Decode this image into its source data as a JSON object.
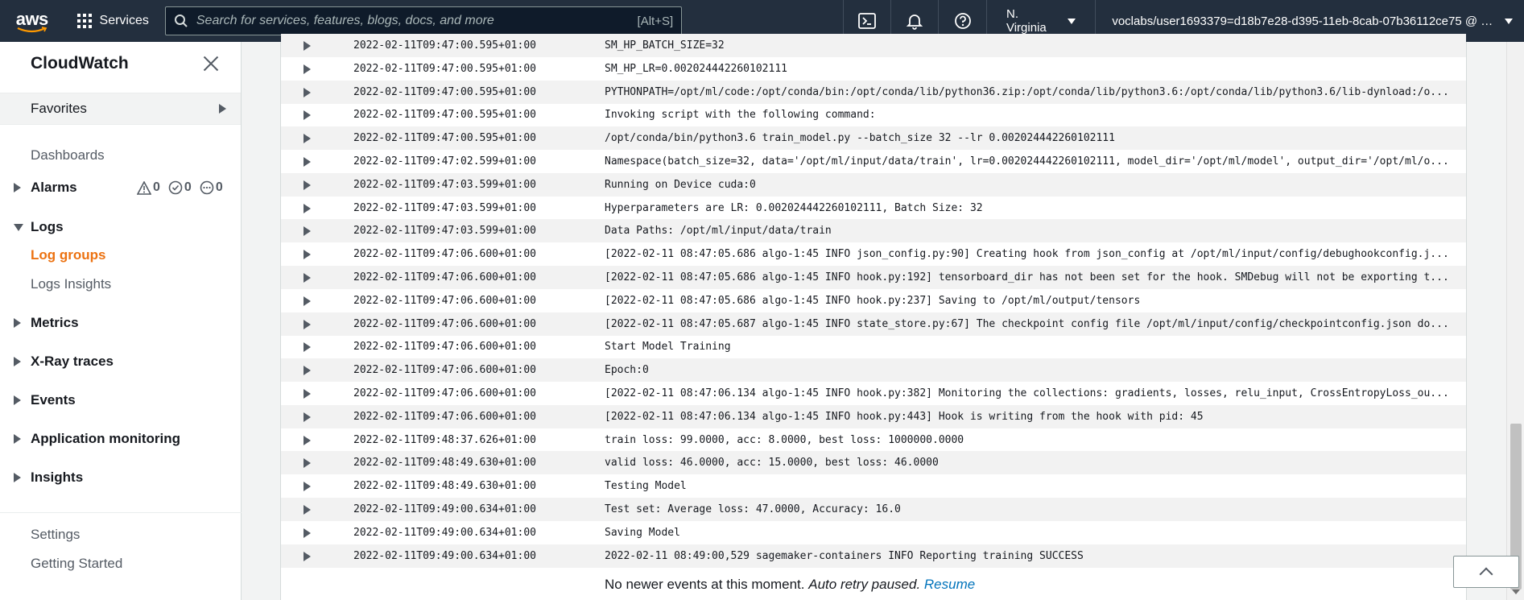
{
  "topnav": {
    "logo_text": "aws",
    "services_label": "Services",
    "search_placeholder": "Search for services, features, blogs, docs, and more",
    "search_shortcut": "[Alt+S]",
    "region": "N. Virginia",
    "account": "voclabs/user1693379=d18b7e28-d395-11eb-8cab-07b36112ce75 @ 32..."
  },
  "sidebar": {
    "title": "CloudWatch",
    "favorites": "Favorites",
    "dashboards": "Dashboards",
    "alarms": "Alarms",
    "alarm_counts": {
      "alarm": "0",
      "ok": "0",
      "insufficient": "0"
    },
    "logs": "Logs",
    "log_groups": "Log groups",
    "logs_insights": "Logs Insights",
    "metrics": "Metrics",
    "xray": "X-Ray traces",
    "events": "Events",
    "app_monitoring": "Application monitoring",
    "insights": "Insights",
    "settings": "Settings",
    "getting_started": "Getting Started"
  },
  "log_events": [
    {
      "ts": "2022-02-11T09:47:00.595+01:00",
      "msg": "SM_HP_BATCH_SIZE=32"
    },
    {
      "ts": "2022-02-11T09:47:00.595+01:00",
      "msg": "SM_HP_LR=0.002024442260102111"
    },
    {
      "ts": "2022-02-11T09:47:00.595+01:00",
      "msg": "PYTHONPATH=/opt/ml/code:/opt/conda/bin:/opt/conda/lib/python36.zip:/opt/conda/lib/python3.6:/opt/conda/lib/python3.6/lib-dynload:/o..."
    },
    {
      "ts": "2022-02-11T09:47:00.595+01:00",
      "msg": "Invoking script with the following command:"
    },
    {
      "ts": "2022-02-11T09:47:00.595+01:00",
      "msg": "/opt/conda/bin/python3.6 train_model.py --batch_size 32 --lr 0.002024442260102111"
    },
    {
      "ts": "2022-02-11T09:47:02.599+01:00",
      "msg": "Namespace(batch_size=32, data='/opt/ml/input/data/train', lr=0.002024442260102111, model_dir='/opt/ml/model', output_dir='/opt/ml/o..."
    },
    {
      "ts": "2022-02-11T09:47:03.599+01:00",
      "msg": "Running on Device cuda:0"
    },
    {
      "ts": "2022-02-11T09:47:03.599+01:00",
      "msg": "Hyperparameters are LR: 0.002024442260102111, Batch Size: 32"
    },
    {
      "ts": "2022-02-11T09:47:03.599+01:00",
      "msg": "Data Paths: /opt/ml/input/data/train"
    },
    {
      "ts": "2022-02-11T09:47:06.600+01:00",
      "msg": "[2022-02-11 08:47:05.686 algo-1:45 INFO json_config.py:90] Creating hook from json_config at /opt/ml/input/config/debughookconfig.j..."
    },
    {
      "ts": "2022-02-11T09:47:06.600+01:00",
      "msg": "[2022-02-11 08:47:05.686 algo-1:45 INFO hook.py:192] tensorboard_dir has not been set for the hook. SMDebug will not be exporting t..."
    },
    {
      "ts": "2022-02-11T09:47:06.600+01:00",
      "msg": "[2022-02-11 08:47:05.686 algo-1:45 INFO hook.py:237] Saving to /opt/ml/output/tensors"
    },
    {
      "ts": "2022-02-11T09:47:06.600+01:00",
      "msg": "[2022-02-11 08:47:05.687 algo-1:45 INFO state_store.py:67] The checkpoint config file /opt/ml/input/config/checkpointconfig.json do..."
    },
    {
      "ts": "2022-02-11T09:47:06.600+01:00",
      "msg": "Start Model Training"
    },
    {
      "ts": "2022-02-11T09:47:06.600+01:00",
      "msg": "Epoch:0"
    },
    {
      "ts": "2022-02-11T09:47:06.600+01:00",
      "msg": "[2022-02-11 08:47:06.134 algo-1:45 INFO hook.py:382] Monitoring the collections: gradients, losses, relu_input, CrossEntropyLoss_ou..."
    },
    {
      "ts": "2022-02-11T09:47:06.600+01:00",
      "msg": "[2022-02-11 08:47:06.134 algo-1:45 INFO hook.py:443] Hook is writing from the hook with pid: 45"
    },
    {
      "ts": "2022-02-11T09:48:37.626+01:00",
      "msg": "train loss: 99.0000, acc: 8.0000, best loss: 1000000.0000"
    },
    {
      "ts": "2022-02-11T09:48:49.630+01:00",
      "msg": "valid loss: 46.0000, acc: 15.0000, best loss: 46.0000"
    },
    {
      "ts": "2022-02-11T09:48:49.630+01:00",
      "msg": "Testing Model"
    },
    {
      "ts": "2022-02-11T09:49:00.634+01:00",
      "msg": "Test set: Average loss: 47.0000, Accuracy: 16.0"
    },
    {
      "ts": "2022-02-11T09:49:00.634+01:00",
      "msg": "Saving Model"
    },
    {
      "ts": "2022-02-11T09:49:00.634+01:00",
      "msg": "2022-02-11 08:49:00,529 sagemaker-containers INFO Reporting training SUCCESS"
    }
  ],
  "footer": {
    "status": "No newer events at this moment.",
    "paused": "Auto retry paused.",
    "resume": "Resume"
  },
  "colors": {
    "nav_bg": "#232f3e",
    "active": "#ec7211",
    "link": "#0073bb"
  }
}
